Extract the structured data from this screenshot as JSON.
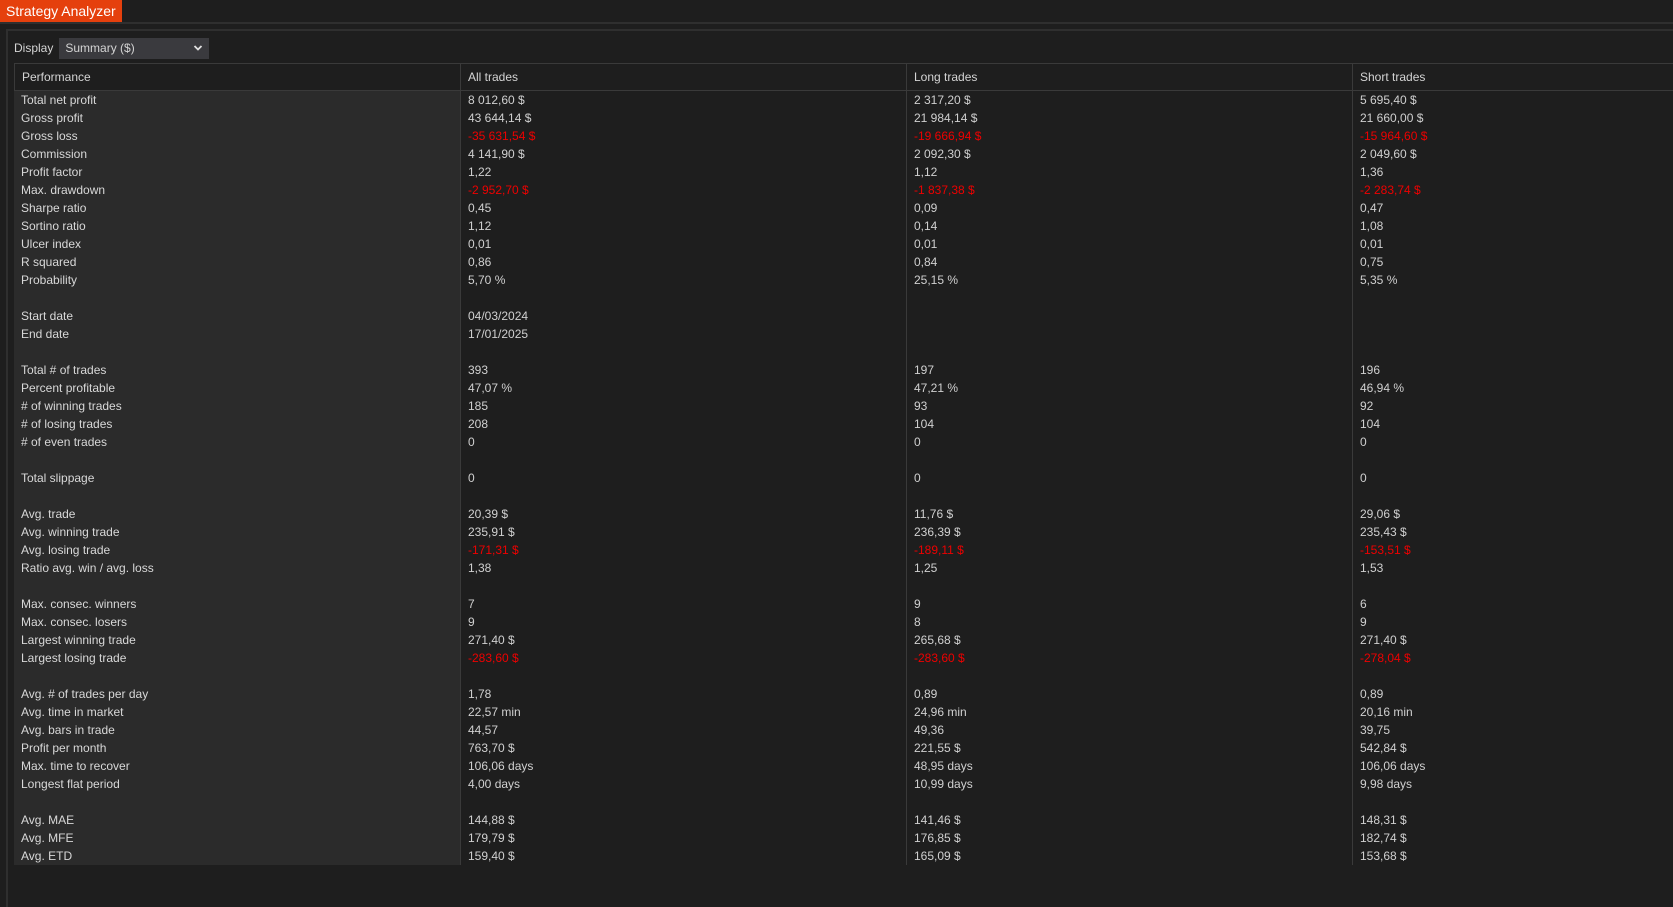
{
  "window": {
    "title": "Strategy Analyzer"
  },
  "display": {
    "label": "Display",
    "selected": "Summary ($)"
  },
  "colors": {
    "accent": "#e5400d",
    "negative": "#ee0000"
  },
  "columns": [
    "Performance",
    "All trades",
    "Long trades",
    "Short trades"
  ],
  "rows": [
    {
      "label": "Total net profit",
      "all": "8 012,60 $",
      "long": "2 317,20 $",
      "short": "5 695,40 $"
    },
    {
      "label": "Gross profit",
      "all": "43 644,14 $",
      "long": "21 984,14 $",
      "short": "21 660,00 $"
    },
    {
      "label": "Gross loss",
      "all": "-35 631,54 $",
      "long": "-19 666,94 $",
      "short": "-15 964,60 $",
      "negative": true
    },
    {
      "label": "Commission",
      "all": "4 141,90 $",
      "long": "2 092,30 $",
      "short": "2 049,60 $"
    },
    {
      "label": "Profit factor",
      "all": "1,22",
      "long": "1,12",
      "short": "1,36"
    },
    {
      "label": "Max. drawdown",
      "all": "-2 952,70 $",
      "long": "-1 837,38 $",
      "short": "-2 283,74 $",
      "negative": true
    },
    {
      "label": "Sharpe ratio",
      "all": "0,45",
      "long": "0,09",
      "short": "0,47"
    },
    {
      "label": "Sortino ratio",
      "all": "1,12",
      "long": "0,14",
      "short": "1,08"
    },
    {
      "label": "Ulcer index",
      "all": "0,01",
      "long": "0,01",
      "short": "0,01"
    },
    {
      "label": "R squared",
      "all": "0,86",
      "long": "0,84",
      "short": "0,75"
    },
    {
      "label": "Probability",
      "all": "5,70 %",
      "long": "25,15 %",
      "short": "5,35 %"
    },
    {
      "label": "",
      "all": "",
      "long": "",
      "short": ""
    },
    {
      "label": "Start date",
      "all": "04/03/2024",
      "long": "",
      "short": ""
    },
    {
      "label": "End date",
      "all": "17/01/2025",
      "long": "",
      "short": ""
    },
    {
      "label": "",
      "all": "",
      "long": "",
      "short": ""
    },
    {
      "label": "Total # of trades",
      "all": "393",
      "long": "197",
      "short": "196"
    },
    {
      "label": "Percent profitable",
      "all": "47,07 %",
      "long": "47,21 %",
      "short": "46,94 %"
    },
    {
      "label": "# of winning trades",
      "all": "185",
      "long": "93",
      "short": "92"
    },
    {
      "label": "# of losing trades",
      "all": "208",
      "long": "104",
      "short": "104"
    },
    {
      "label": "# of even trades",
      "all": "0",
      "long": "0",
      "short": "0"
    },
    {
      "label": "",
      "all": "",
      "long": "",
      "short": ""
    },
    {
      "label": "Total slippage",
      "all": "0",
      "long": "0",
      "short": "0"
    },
    {
      "label": "",
      "all": "",
      "long": "",
      "short": ""
    },
    {
      "label": "Avg. trade",
      "all": "20,39 $",
      "long": "11,76 $",
      "short": "29,06 $"
    },
    {
      "label": "Avg. winning trade",
      "all": "235,91 $",
      "long": "236,39 $",
      "short": "235,43 $"
    },
    {
      "label": "Avg. losing trade",
      "all": "-171,31 $",
      "long": "-189,11 $",
      "short": "-153,51 $",
      "negative": true
    },
    {
      "label": "Ratio avg. win / avg. loss",
      "all": "1,38",
      "long": "1,25",
      "short": "1,53"
    },
    {
      "label": "",
      "all": "",
      "long": "",
      "short": ""
    },
    {
      "label": "Max. consec. winners",
      "all": "7",
      "long": "9",
      "short": "6"
    },
    {
      "label": "Max. consec. losers",
      "all": "9",
      "long": "8",
      "short": "9"
    },
    {
      "label": "Largest winning trade",
      "all": "271,40 $",
      "long": "265,68 $",
      "short": "271,40 $"
    },
    {
      "label": "Largest losing trade",
      "all": "-283,60 $",
      "long": "-283,60 $",
      "short": "-278,04 $",
      "negative": true
    },
    {
      "label": "",
      "all": "",
      "long": "",
      "short": ""
    },
    {
      "label": "Avg. # of trades per day",
      "all": "1,78",
      "long": "0,89",
      "short": "0,89"
    },
    {
      "label": "Avg. time in market",
      "all": "22,57 min",
      "long": "24,96 min",
      "short": "20,16 min"
    },
    {
      "label": "Avg. bars in trade",
      "all": "44,57",
      "long": "49,36",
      "short": "39,75"
    },
    {
      "label": "Profit per month",
      "all": "763,70 $",
      "long": "221,55 $",
      "short": "542,84 $"
    },
    {
      "label": "Max. time to recover",
      "all": "106,06 days",
      "long": "48,95 days",
      "short": "106,06 days"
    },
    {
      "label": "Longest flat period",
      "all": "4,00 days",
      "long": "10,99 days",
      "short": "9,98 days"
    },
    {
      "label": "",
      "all": "",
      "long": "",
      "short": ""
    },
    {
      "label": "Avg. MAE",
      "all": "144,88 $",
      "long": "141,46 $",
      "short": "148,31 $"
    },
    {
      "label": "Avg. MFE",
      "all": "179,79 $",
      "long": "176,85 $",
      "short": "182,74 $"
    },
    {
      "label": "Avg. ETD",
      "all": "159,40 $",
      "long": "165,09 $",
      "short": "153,68 $"
    }
  ]
}
